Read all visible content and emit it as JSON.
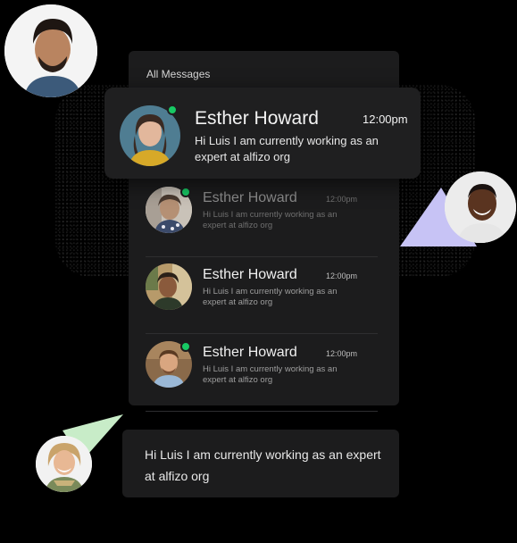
{
  "panel": {
    "title": "All Messages"
  },
  "active": {
    "name": "Esther Howard",
    "time": "12:00pm",
    "message": "Hi Luis I am currently working as an expert at alfizo org",
    "online": true
  },
  "rows": [
    {
      "name": "Esther Howard",
      "time": "12:00pm",
      "message": "Hi Luis I am currently working as an expert at alfizo org",
      "online": true
    },
    {
      "name": "Esther Howard",
      "time": "12:00pm",
      "message": "Hi Luis I am currently working as an expert at alfizo org",
      "online": false
    },
    {
      "name": "Esther Howard",
      "time": "12:00pm",
      "message": "Hi Luis I am currently working as an expert at alfizo org",
      "online": true
    }
  ],
  "bubble": {
    "text": "Hi Luis I am currently working as an expert at alfizo org"
  },
  "colors": {
    "background": "#000000",
    "panel": "#1c1c1d",
    "online": "#17c964",
    "triangle_purple": "#c7c3f5",
    "triangle_green": "#c8ecc8"
  },
  "icons": {
    "online_indicator": "status-dot-icon"
  }
}
